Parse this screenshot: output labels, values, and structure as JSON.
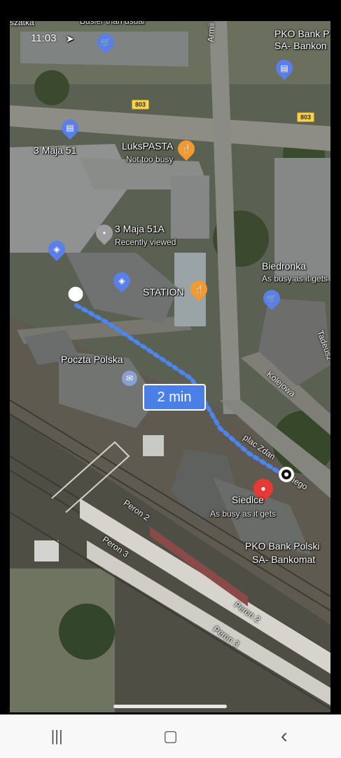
{
  "status": {
    "time": "11:03"
  },
  "map": {
    "route_duration": "2 min",
    "road_shields": [
      "803",
      "803"
    ],
    "places": [
      {
        "name": "3 Maja 51",
        "sub": ""
      },
      {
        "name": "LuksPASTA",
        "sub": "Not too busy"
      },
      {
        "name": "3 Maja 51A",
        "sub": "Recently viewed"
      },
      {
        "name": "STATION",
        "sub": ""
      },
      {
        "name": "Poczta Polska",
        "sub": ""
      },
      {
        "name": "Biedronka",
        "sub": "As busy as it gets"
      },
      {
        "name": "Siedlce",
        "sub": "As busy as it gets"
      },
      {
        "name": "PKO Bank Polski",
        "sub": "SA- Bankomat"
      },
      {
        "name": "PKO Bank P",
        "sub": "SA- Bankon"
      }
    ],
    "streets": [
      "Armii Kra",
      "Kolejowa",
      "plac Zdan",
      "iego",
      "Tadeusz",
      "Peron 2",
      "Peron 3",
      "Peron 2",
      "Peron 3"
    ],
    "top_partial": "Busier than usual",
    "top_left_partial": "szatka"
  },
  "navbar": {
    "recent": "|||",
    "home": "▢",
    "back": "‹"
  }
}
